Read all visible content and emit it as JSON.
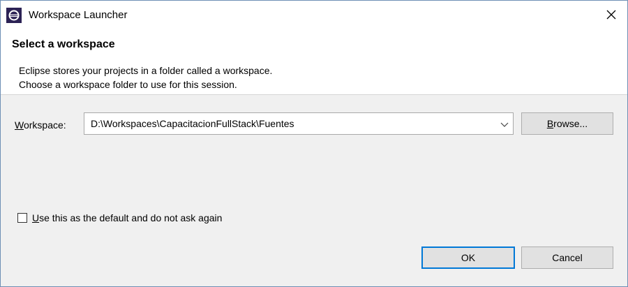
{
  "window": {
    "title": "Workspace Launcher",
    "close_glyph": "✕",
    "app_icon": "eclipse-icon"
  },
  "header": {
    "title": "Select a workspace",
    "description_line1": "Eclipse stores your projects in a folder called a workspace.",
    "description_line2": "Choose a workspace folder to use for this session."
  },
  "workspace": {
    "label_mnemonic": "W",
    "label_rest": "orkspace:",
    "value": "D:\\Workspaces\\CapacitacionFullStack\\Fuentes",
    "dropdown_icon": "chevron-down-icon"
  },
  "buttons": {
    "browse_mnemonic": "B",
    "browse_rest": "rowse...",
    "ok": "OK",
    "cancel": "Cancel"
  },
  "checkbox": {
    "checked": false,
    "label_mnemonic": "U",
    "label_rest": "se this as the default and do not ask again"
  }
}
